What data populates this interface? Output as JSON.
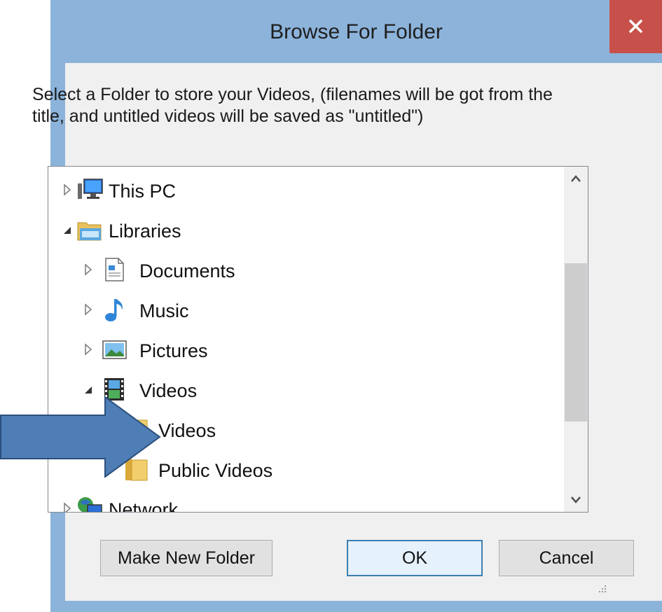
{
  "window": {
    "title": "Browse For Folder",
    "close_glyph": "✕"
  },
  "description": "Select a Folder to store your Videos, (filenames will be got from the title, and untitled videos will be saved as \"untitled\")",
  "tree": {
    "items": [
      {
        "label": "This PC",
        "icon": "computer-icon",
        "expanded": false
      },
      {
        "label": "Libraries",
        "icon": "libraries-folder-icon",
        "expanded": true
      },
      {
        "label": "Documents",
        "icon": "documents-icon",
        "expanded": false
      },
      {
        "label": "Music",
        "icon": "music-note-icon",
        "expanded": false
      },
      {
        "label": "Pictures",
        "icon": "pictures-icon",
        "expanded": false
      },
      {
        "label": "Videos",
        "icon": "film-strip-icon",
        "expanded": true
      },
      {
        "label": "Videos",
        "icon": "video-folder-icon",
        "expanded": false
      },
      {
        "label": "Public Videos",
        "icon": "folder-icon",
        "expanded": null
      },
      {
        "label": "Network",
        "icon": "network-icon",
        "expanded": false
      }
    ]
  },
  "buttons": {
    "make_new_folder": "Make New Folder",
    "ok": "OK",
    "cancel": "Cancel"
  },
  "colors": {
    "frame": "#8cb3da",
    "close": "#c7514a",
    "arrow_fill": "#4f7db5",
    "arrow_stroke": "#2b4f7c"
  }
}
